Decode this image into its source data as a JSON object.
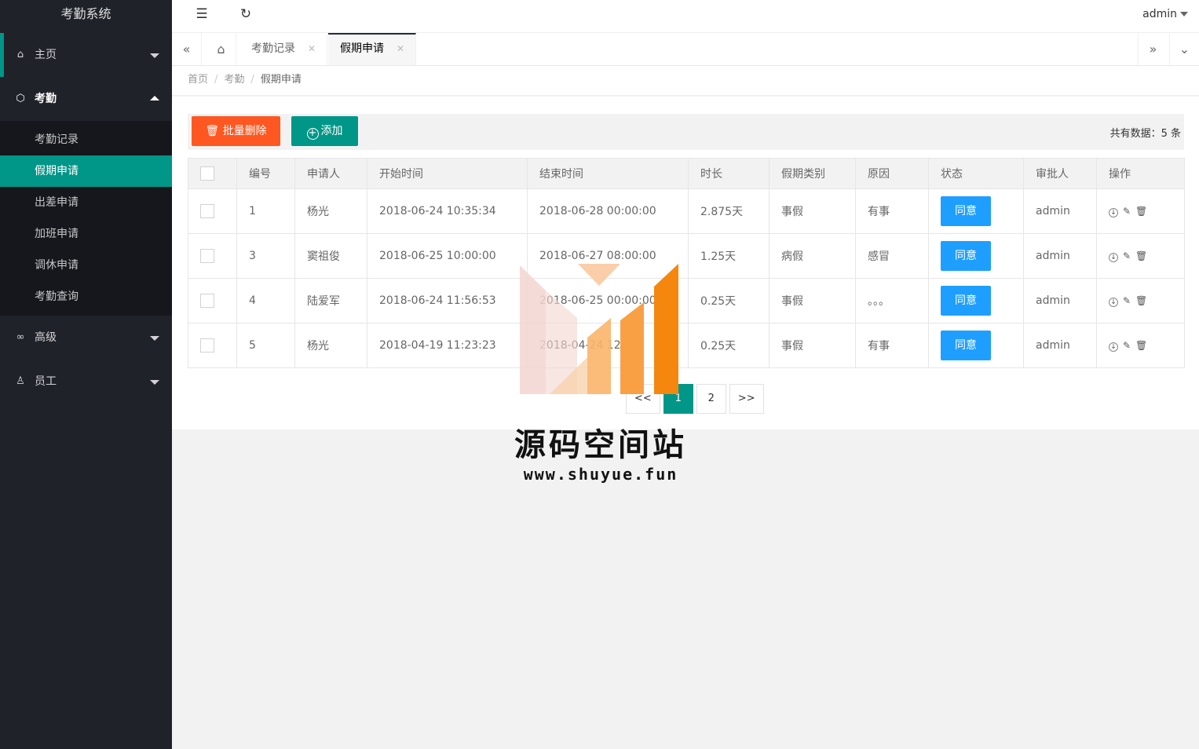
{
  "app": {
    "title": "考勤系统"
  },
  "sidebar": {
    "items": [
      {
        "label": "主页",
        "icon": "home-icon"
      },
      {
        "label": "考勤",
        "icon": "cube-icon",
        "children": [
          "考勤记录",
          "假期申请",
          "出差申请",
          "加班申请",
          "调休申请",
          "考勤查询"
        ],
        "active_child": "假期申请"
      },
      {
        "label": "高级",
        "icon": "link-icon"
      },
      {
        "label": "员工",
        "icon": "user-icon"
      }
    ]
  },
  "header": {
    "user": "admin"
  },
  "tabs": [
    {
      "label": "考勤记录"
    },
    {
      "label": "假期申请"
    }
  ],
  "breadcrumb": [
    "首页",
    "考勤",
    "假期申请"
  ],
  "toolbar": {
    "batch_delete": "批量删除",
    "add": "添加",
    "total_label": "共有数据：5 条"
  },
  "table": {
    "columns": [
      "编号",
      "申请人",
      "开始时间",
      "结束时间",
      "时长",
      "假期类别",
      "原因",
      "状态",
      "审批人",
      "操作"
    ],
    "rows": [
      {
        "id": "1",
        "applicant": "杨光",
        "start": "2018-06-24 10:35:34",
        "end": "2018-06-28 00:00:00",
        "duration": "2.875天",
        "type": "事假",
        "reason": "有事",
        "status": "同意",
        "approver": "admin"
      },
      {
        "id": "3",
        "applicant": "窦祖俊",
        "start": "2018-06-25 10:00:00",
        "end": "2018-06-27 08:00:00",
        "duration": "1.25天",
        "type": "病假",
        "reason": "感冒",
        "status": "同意",
        "approver": "admin"
      },
      {
        "id": "4",
        "applicant": "陆爱军",
        "start": "2018-06-24 11:56:53",
        "end": "2018-06-25 00:00:00",
        "duration": "0.25天",
        "type": "事假",
        "reason": "。。。",
        "status": "同意",
        "approver": "admin"
      },
      {
        "id": "5",
        "applicant": "杨光",
        "start": "2018-04-19 11:23:23",
        "end": "2018-04-24 12",
        "duration": "0.25天",
        "type": "事假",
        "reason": "有事",
        "status": "同意",
        "approver": "admin"
      }
    ]
  },
  "pagination": {
    "prev": "<<",
    "pages": [
      "1",
      "2"
    ],
    "current": "1",
    "next": ">>"
  },
  "watermark": {
    "text": "源码空间站",
    "url": "www.shuyue.fun"
  },
  "colors": {
    "sidebar_bg": "#20222a",
    "accent": "#009688",
    "danger": "#ff5722",
    "info": "#1e9fff"
  }
}
